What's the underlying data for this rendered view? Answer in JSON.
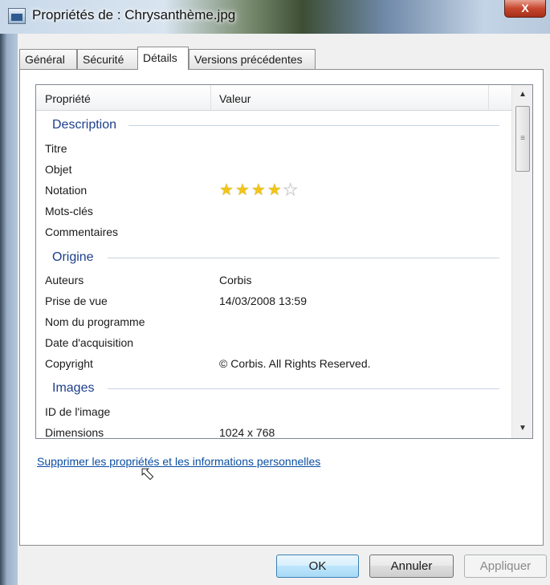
{
  "window": {
    "title": "Propriétés de : Chrysanthème.jpg",
    "close_label": "X"
  },
  "tabs": [
    {
      "label": "Général"
    },
    {
      "label": "Sécurité"
    },
    {
      "label": "Détails",
      "active": true
    },
    {
      "label": "Versions précédentes"
    }
  ],
  "table": {
    "col_property": "Propriété",
    "col_value": "Valeur"
  },
  "groups": {
    "description": "Description",
    "origine": "Origine",
    "images": "Images"
  },
  "rows": {
    "titre": {
      "label": "Titre",
      "value": ""
    },
    "objet": {
      "label": "Objet",
      "value": ""
    },
    "notation": {
      "label": "Notation",
      "rating": 4,
      "max": 5
    },
    "mots_cles": {
      "label": "Mots-clés",
      "value": ""
    },
    "commentaires": {
      "label": "Commentaires",
      "value": ""
    },
    "auteurs": {
      "label": "Auteurs",
      "value": "Corbis"
    },
    "prise_de_vue": {
      "label": "Prise de vue",
      "value": "14/03/2008 13:59"
    },
    "nom_programme": {
      "label": "Nom du programme",
      "value": ""
    },
    "date_acquisition": {
      "label": "Date d'acquisition",
      "value": ""
    },
    "copyright": {
      "label": "Copyright",
      "value": "© Corbis.  All Rights Reserved."
    },
    "id_image": {
      "label": "ID de l'image",
      "value": ""
    },
    "dimensions": {
      "label": "Dimensions",
      "value": "1024 x 768"
    }
  },
  "link": {
    "text": "Supprimer les propriétés et les informations personnelles"
  },
  "buttons": {
    "ok": "OK",
    "cancel": "Annuler",
    "apply": "Appliquer"
  },
  "colors": {
    "group_heading": "#1e3f8c",
    "link": "#0b4ea2",
    "star": "#f0c419"
  }
}
